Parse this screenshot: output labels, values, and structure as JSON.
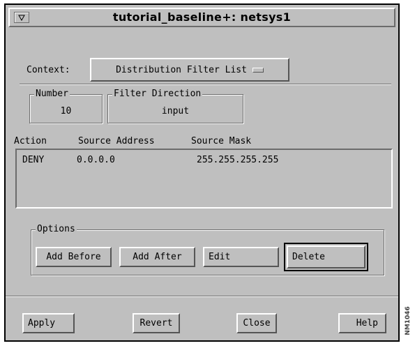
{
  "window": {
    "title": "tutorial_baseline+: netsys1"
  },
  "context": {
    "label": "Context:",
    "selected": "Distribution Filter List"
  },
  "number_box": {
    "legend": "Number",
    "value": "10"
  },
  "direction_box": {
    "legend": "Filter Direction",
    "value": "input"
  },
  "table": {
    "columns": [
      "Action",
      "Source Address",
      "Source Mask"
    ],
    "rows": [
      {
        "action": "DENY",
        "source_address": "0.0.0.0",
        "source_mask": "255.255.255.255"
      }
    ]
  },
  "options": {
    "legend": "Options",
    "add_before": "Add Before",
    "add_after": "Add After",
    "edit": "Edit",
    "delete": "Delete"
  },
  "footer": {
    "apply": "Apply",
    "revert": "Revert",
    "close": "Close",
    "help": "Help"
  },
  "figure_code": "NM1046",
  "icons": {
    "window_menu": "window-menu-icon",
    "option_indicator": "dropdown-indicator-icon"
  },
  "colors": {
    "background": "#bfbfbf",
    "shadow": "#6b6b6b",
    "highlight": "#ffffff"
  }
}
